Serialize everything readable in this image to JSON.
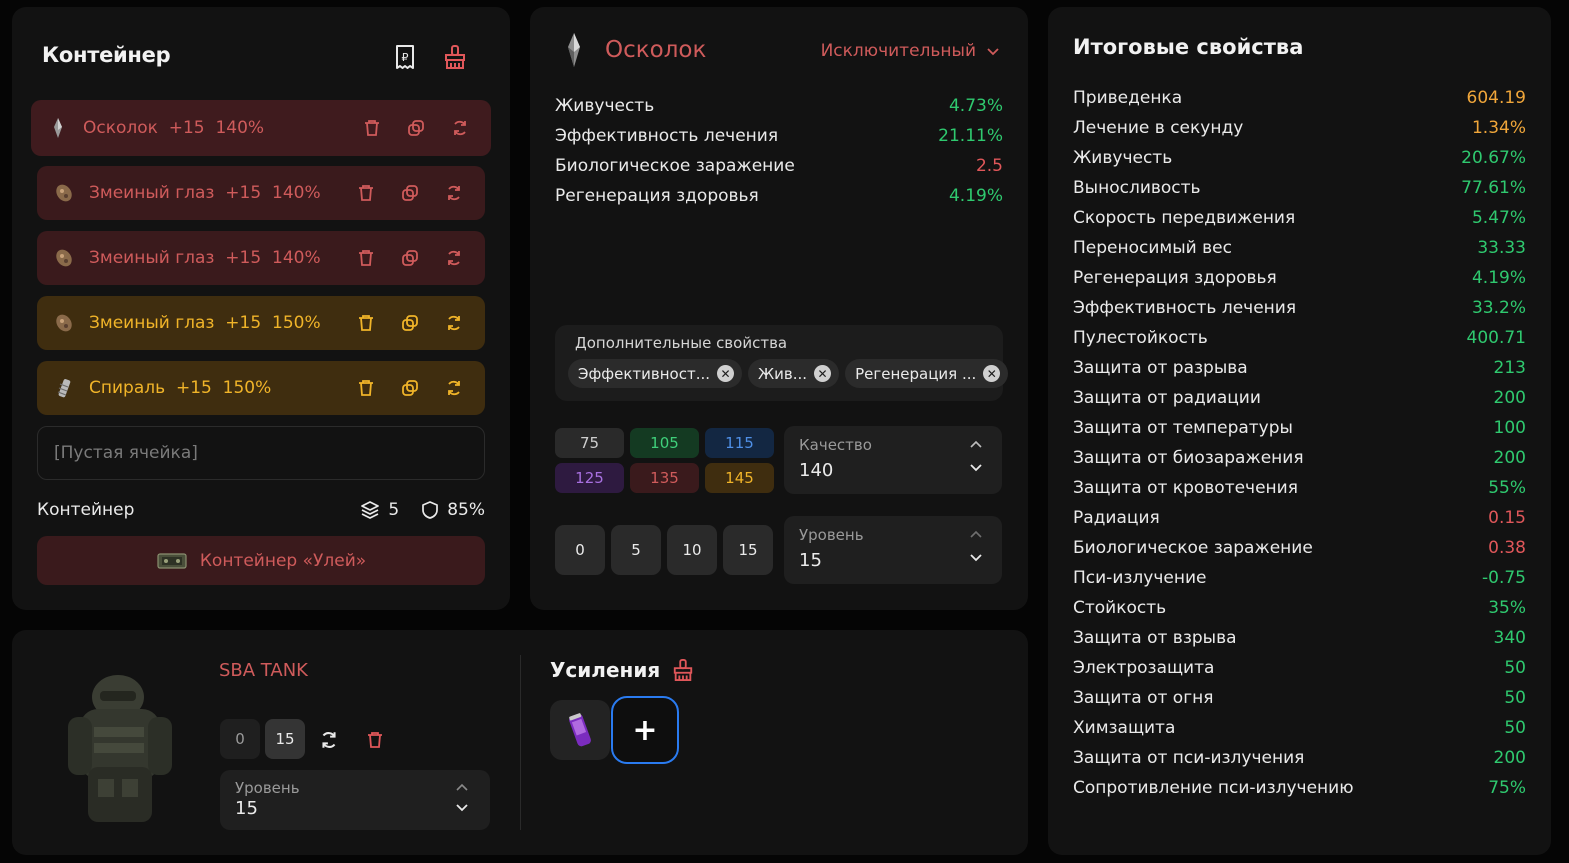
{
  "container": {
    "title": "Контейнер",
    "slots": [
      {
        "name": "Осколок",
        "boost": "+15",
        "quality": "140%",
        "tone": "red"
      },
      {
        "name": "Змеиный глаз",
        "boost": "+15",
        "quality": "140%",
        "tone": "red"
      },
      {
        "name": "Змеиный глаз",
        "boost": "+15",
        "quality": "140%",
        "tone": "red"
      },
      {
        "name": "Змеиный глаз",
        "boost": "+15",
        "quality": "150%",
        "tone": "gold"
      },
      {
        "name": "Спираль",
        "boost": "+15",
        "quality": "150%",
        "tone": "gold"
      }
    ],
    "empty_slot": "[Пустая ячейка]",
    "footer_label": "Контейнер",
    "capacity": "5",
    "protection": "85%",
    "container_name": "Контейнер «Улей»"
  },
  "artifact": {
    "name": "Осколок",
    "rarity": "Исключительный",
    "properties": [
      {
        "label": "Живучесть",
        "value": "4.73%",
        "color": "#2fc96f"
      },
      {
        "label": "Эффективность лечения",
        "value": "21.11%",
        "color": "#2fc96f"
      },
      {
        "label": "Биологическое заражение",
        "value": "2.5",
        "color": "#e0575a"
      },
      {
        "label": "Регенерация здоровья",
        "value": "4.19%",
        "color": "#2fc96f"
      }
    ],
    "extra_label": "Дополнительные свойства",
    "extra_chips": [
      "Эффективност...",
      "Жив...",
      "Регенерация ..."
    ],
    "quality_presets": [
      {
        "value": "75",
        "bg": "#2a2a2a",
        "fg": "#cfcfcf"
      },
      {
        "value": "105",
        "bg": "#143a22",
        "fg": "#3fcf7a"
      },
      {
        "value": "115",
        "bg": "#132742",
        "fg": "#4f8fe6"
      },
      {
        "value": "125",
        "bg": "#2e1a40",
        "fg": "#a870e0"
      },
      {
        "value": "135",
        "bg": "#3a1a1c",
        "fg": "#cf5b5b"
      },
      {
        "value": "145",
        "bg": "#3f2d0f",
        "fg": "#f0b429"
      }
    ],
    "quality_label": "Качество",
    "quality_value": "140",
    "level_presets": [
      "0",
      "5",
      "10",
      "15"
    ],
    "level_label": "Уровень",
    "level_value": "15"
  },
  "armor": {
    "name": "SBA TANK",
    "level_presets": [
      "0",
      "15"
    ],
    "level_label": "Уровень",
    "level_value": "15",
    "boosts_title": "Усиления",
    "add_label": "+"
  },
  "summary": {
    "title": "Итоговые свойства",
    "rows": [
      {
        "label": "Приведенка",
        "value": "604.19",
        "color": "#f0a63a"
      },
      {
        "label": "Лечение в секунду",
        "value": "1.34%",
        "color": "#f0a63a"
      },
      {
        "label": "Живучесть",
        "value": "20.67%",
        "color": "#2fc96f"
      },
      {
        "label": "Выносливость",
        "value": "77.61%",
        "color": "#2fc96f"
      },
      {
        "label": "Скорость передвижения",
        "value": "5.47%",
        "color": "#2fc96f"
      },
      {
        "label": "Переносимый вес",
        "value": "33.33",
        "color": "#2fc96f"
      },
      {
        "label": "Регенерация здоровья",
        "value": "4.19%",
        "color": "#2fc96f"
      },
      {
        "label": "Эффективность лечения",
        "value": "33.2%",
        "color": "#2fc96f"
      },
      {
        "label": "Пулестойкость",
        "value": "400.71",
        "color": "#2fc96f"
      },
      {
        "label": "Защита от разрыва",
        "value": "213",
        "color": "#2fc96f"
      },
      {
        "label": "Защита от радиации",
        "value": "200",
        "color": "#2fc96f"
      },
      {
        "label": "Защита от температуры",
        "value": "100",
        "color": "#2fc96f"
      },
      {
        "label": "Защита от биозаражения",
        "value": "200",
        "color": "#2fc96f"
      },
      {
        "label": "Защита от кровотечения",
        "value": "55%",
        "color": "#2fc96f"
      },
      {
        "label": "Радиация",
        "value": "0.15",
        "color": "#e0575a"
      },
      {
        "label": "Биологическое заражение",
        "value": "0.38",
        "color": "#e0575a"
      },
      {
        "label": "Пси-излучение",
        "value": "-0.75",
        "color": "#2fc96f"
      },
      {
        "label": "Стойкость",
        "value": "35%",
        "color": "#2fc96f"
      },
      {
        "label": "Защита от взрыва",
        "value": "340",
        "color": "#2fc96f"
      },
      {
        "label": "Электрозащита",
        "value": "50",
        "color": "#2fc96f"
      },
      {
        "label": "Защита от огня",
        "value": "50",
        "color": "#2fc96f"
      },
      {
        "label": "Химзащита",
        "value": "50",
        "color": "#2fc96f"
      },
      {
        "label": "Защита от пси-излучения",
        "value": "200",
        "color": "#2fc96f"
      },
      {
        "label": "Сопротивление пси-излучению",
        "value": "75%",
        "color": "#2fc96f"
      }
    ]
  }
}
